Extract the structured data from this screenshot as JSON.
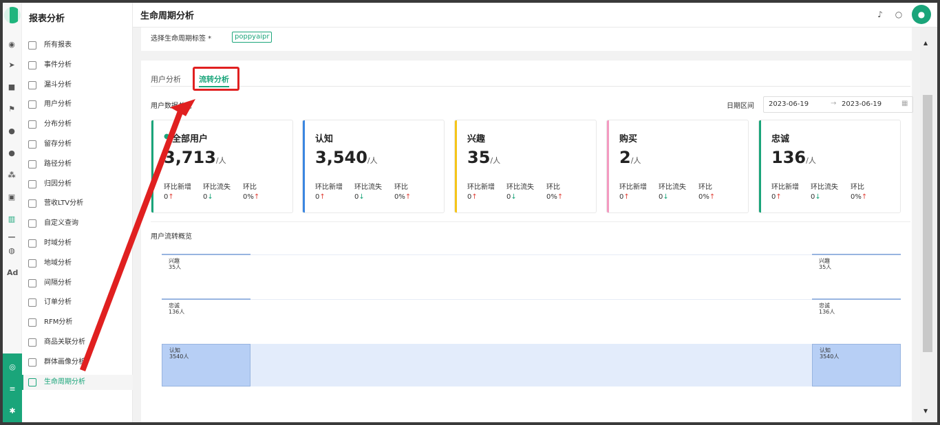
{
  "sidebar": {
    "title": "报表分析",
    "items": [
      {
        "label": "所有报表",
        "icon": "chart-icon"
      },
      {
        "label": "事件分析",
        "icon": "edit-icon"
      },
      {
        "label": "漏斗分析",
        "icon": "funnel-icon"
      },
      {
        "label": "用户分析",
        "icon": "user-icon"
      },
      {
        "label": "分布分析",
        "icon": "distribution-icon"
      },
      {
        "label": "留存分析",
        "icon": "dots-icon"
      },
      {
        "label": "路径分析",
        "icon": "path-icon"
      },
      {
        "label": "归因分析",
        "icon": "attribution-icon"
      },
      {
        "label": "营收LTV分析",
        "icon": "revenue-icon"
      },
      {
        "label": "自定义查询",
        "icon": "query-icon"
      },
      {
        "label": "时域分析",
        "icon": "bar-chart-icon"
      },
      {
        "label": "地域分析",
        "icon": "map-icon"
      },
      {
        "label": "间隔分析",
        "icon": "interval-icon"
      },
      {
        "label": "订单分析",
        "icon": "order-icon"
      },
      {
        "label": "RFM分析",
        "icon": "rfm-icon"
      },
      {
        "label": "商品关联分析",
        "icon": "association-icon"
      },
      {
        "label": "群体画像分析",
        "icon": "portrait-icon"
      },
      {
        "label": "生命周期分析",
        "icon": "lifecycle-icon",
        "active": true
      }
    ]
  },
  "rail": {
    "ad_label": "Ad"
  },
  "header": {
    "title": "生命周期分析"
  },
  "filter": {
    "label": "选择生命周期标签 *",
    "tag": "poppyaipr"
  },
  "tabs": [
    {
      "label": "用户分析",
      "active": false
    },
    {
      "label": "流转分析",
      "active": true
    }
  ],
  "overview": {
    "title": "用户数据总览",
    "date_label": "日期区间",
    "date_start": "2023-06-19",
    "date_arrow": "→",
    "date_end": "2023-06-19"
  },
  "cards": [
    {
      "name": "全部用户",
      "value": "3,713",
      "unit": "/人",
      "color": "#1aa57a",
      "m1": "环比新增",
      "m2": "环比流失",
      "m3": "环比",
      "v1": "0",
      "v2": "0",
      "v3": "0%"
    },
    {
      "name": "认知",
      "value": "3,540",
      "unit": "/人",
      "color": "#3a86e0",
      "m1": "环比新增",
      "m2": "环比流失",
      "m3": "环比",
      "v1": "0",
      "v2": "0",
      "v3": "0%"
    },
    {
      "name": "兴趣",
      "value": "35",
      "unit": "/人",
      "color": "#f5c518",
      "m1": "环比新增",
      "m2": "环比流失",
      "m3": "环比",
      "v1": "0",
      "v2": "0",
      "v3": "0%"
    },
    {
      "name": "购买",
      "value": "2",
      "unit": "/人",
      "color": "#f49ac1",
      "m1": "环比新增",
      "m2": "环比流失",
      "m3": "环比",
      "v1": "0",
      "v2": "0",
      "v3": "0%"
    },
    {
      "name": "忠诚",
      "value": "136",
      "unit": "/人",
      "color": "#1aa57a",
      "m1": "环比新增",
      "m2": "环比流失",
      "m3": "环比",
      "v1": "0",
      "v2": "0",
      "v3": "0%"
    }
  ],
  "arrows": {
    "up": "↑",
    "down": "↓"
  },
  "flow": {
    "title": "用户流转概览",
    "nodes": [
      {
        "name": "兴趣",
        "count": "35人"
      },
      {
        "name": "忠诚",
        "count": "136人"
      },
      {
        "name": "认知",
        "count": "3540人"
      }
    ]
  },
  "colors": {
    "accent": "#1aa57a",
    "annotation": "#e02020"
  }
}
